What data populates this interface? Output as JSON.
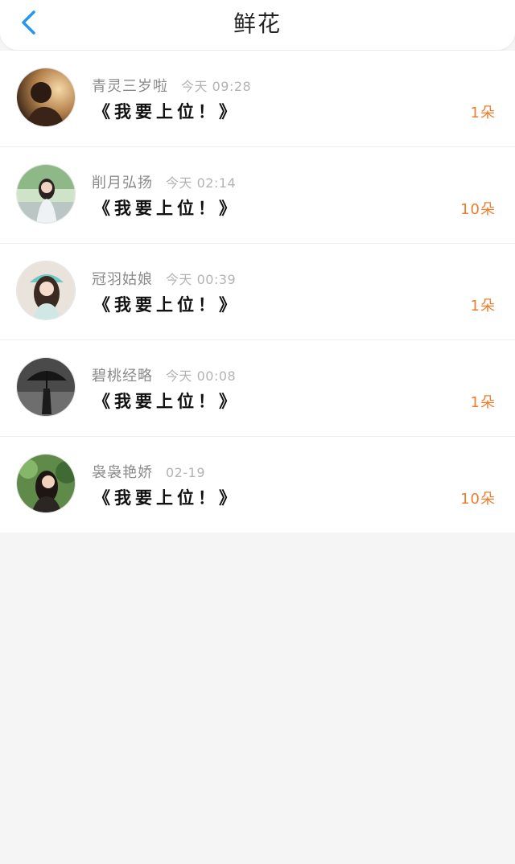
{
  "header": {
    "title": "鲜花",
    "back_icon": "chevron-left-icon",
    "accent_color": "#2196f3"
  },
  "items": [
    {
      "name": "青灵三岁啦",
      "time": "今天 09:28",
      "message": "《我要上位！》",
      "amount": "1朵"
    },
    {
      "name": "削月弘扬",
      "time": "今天 02:14",
      "message": "《我要上位！》",
      "amount": "10朵"
    },
    {
      "name": "冠羽姑娘",
      "time": "今天 00:39",
      "message": "《我要上位！》",
      "amount": "1朵"
    },
    {
      "name": "碧桃经略",
      "time": "今天 00:08",
      "message": "《我要上位！》",
      "amount": "1朵"
    },
    {
      "name": "袅袅艳娇",
      "time": "02-19",
      "message": "《我要上位！》",
      "amount": "10朵"
    }
  ],
  "colors": {
    "amount": "#f07c2c",
    "name": "#8a8a8a",
    "time": "#b3b3b3",
    "background": "#f5f5f5"
  }
}
